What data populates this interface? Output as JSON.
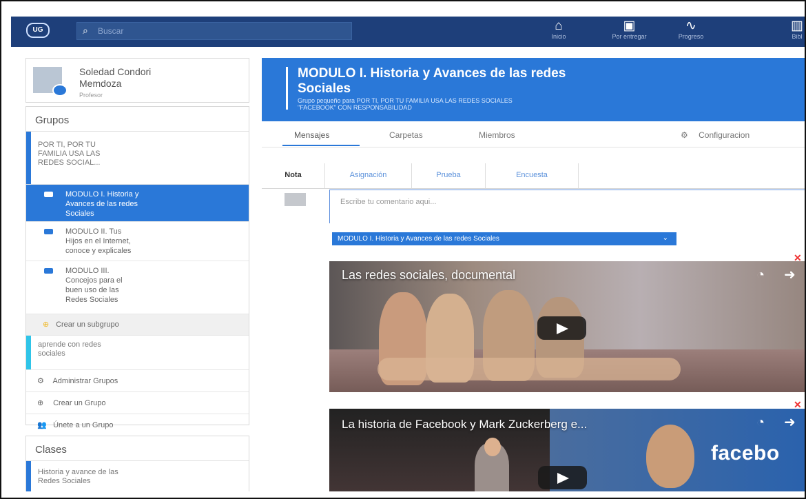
{
  "topbar": {
    "logo": "UG",
    "search_placeholder": "Buscar",
    "nav": [
      {
        "label": "Inicio",
        "icon": "home-icon"
      },
      {
        "label": "Por entregar",
        "icon": "inbox-icon"
      },
      {
        "label": "Progreso",
        "icon": "progress-icon"
      },
      {
        "label": "Bibl",
        "icon": "library-icon"
      }
    ]
  },
  "profile": {
    "name_line1": "Soledad Condori",
    "name_line2": "Memdoza",
    "role": "Profesor"
  },
  "groups": {
    "title": "Grupos",
    "parent_line1": "POR TI, POR TU",
    "parent_line2": "FAMILIA USA LAS",
    "parent_line3": "REDES SOCIAL...",
    "modules": [
      {
        "line1": "MODULO I. Historia y",
        "line2": "Avances de las redes",
        "line3": "Sociales"
      },
      {
        "line1": "MODULO II. Tus",
        "line2": "Hijos en el Internet,",
        "line3": "conoce y explicales"
      },
      {
        "line1": "MODULO III.",
        "line2": "Concejos para el",
        "line3": "buen uso de las",
        "line4": "Redes Sociales"
      }
    ],
    "create_subgroup": "Crear un subgrupo",
    "learn_line1": "aprende con redes",
    "learn_line2": "sociales",
    "manage": "Administrar Grupos",
    "create_group": "Crear un Grupo",
    "join_group": "Únete a un Grupo"
  },
  "classes": {
    "title": "Clases",
    "item_line1": "Historia y avance de las",
    "item_line2": "Redes Sociales"
  },
  "hero": {
    "title_line1": "MODULO I. Historia y Avances de las redes",
    "title_line2": "Sociales",
    "desc_line1": "Grupo pequeño para POR TI, POR TU FAMILIA USA LAS REDES SOCIALES",
    "desc_line2": "\"FACEBOOK\" CON RESPONSABILIDAD"
  },
  "tabs": {
    "messages": "Mensajes",
    "folders": "Carpetas",
    "members": "Miembros",
    "settings": "Configuracion"
  },
  "post_tabs": {
    "note": "Nota",
    "assignment": "Asignación",
    "quiz": "Prueba",
    "poll": "Encuesta"
  },
  "composer": {
    "placeholder": "Escribe tu comentario aqui...",
    "selected_group": "MODULO I. Historia y Avances de las redes Sociales"
  },
  "videos": [
    {
      "title": "Las redes sociales, documental"
    },
    {
      "title": "La historia de Facebook y Mark Zuckerberg e...",
      "brand": "facebo"
    }
  ],
  "colors": {
    "brand_blue": "#2a78d8",
    "dark_blue": "#1e3f7a",
    "delete_red": "#ef3232"
  }
}
